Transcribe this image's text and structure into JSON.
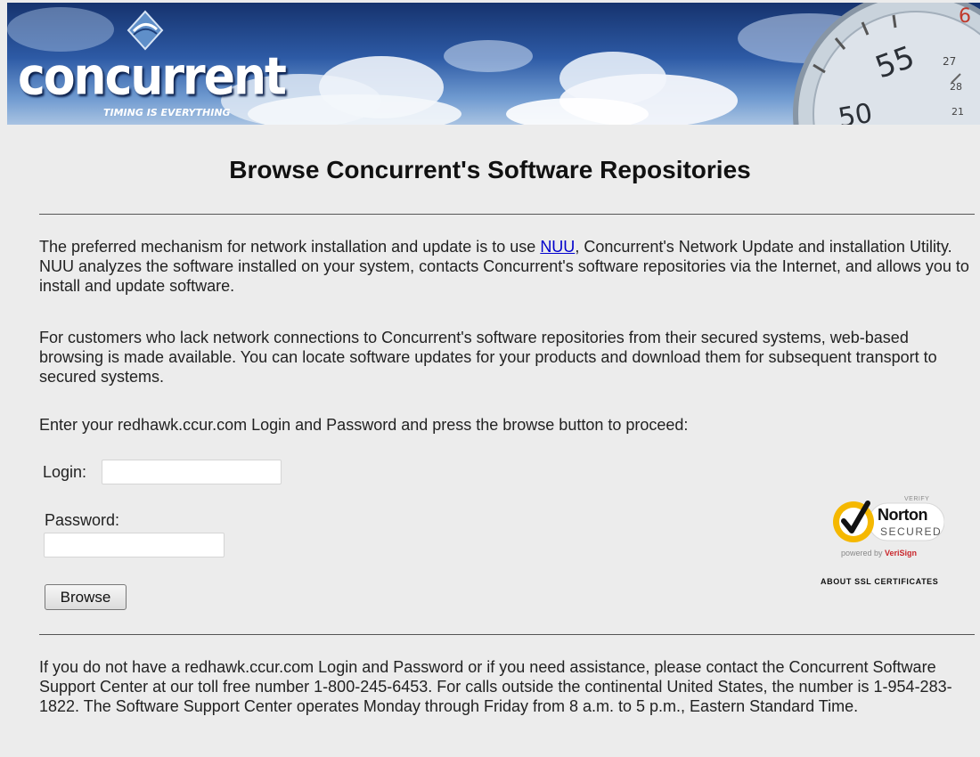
{
  "banner": {
    "logo_text": "concurrent",
    "tagline": "TIMING IS EVERYTHING",
    "stopwatch_numbers": [
      "55",
      "50",
      "6",
      "27",
      "28",
      "21"
    ]
  },
  "page_title": "Browse Concurrent's Software Repositories",
  "intro": {
    "before_link": "The preferred mechanism for network installation and update is to use ",
    "link_text": "NUU",
    "after_link": ", Concurrent's Network Update and installation Utility. NUU analyzes the software installed on your system, contacts Concurrent's software repositories via the Internet, and allows you to install and update software."
  },
  "paragraph_2": "For customers who lack network connections to Concurrent's software repositories from their secured systems, web-based browsing is made available. You can locate software updates for your products and download them for subsequent transport to secured systems.",
  "instructions": "Enter your redhawk.ccur.com Login and Password and press the browse button to proceed:",
  "form": {
    "login_label": "Login:",
    "login_value": "",
    "password_label": "Password:",
    "password_value": "",
    "browse_label": "Browse"
  },
  "norton": {
    "verify": "VERIFY",
    "name": "Norton",
    "secured": "SECURED",
    "powered_prefix": "powered by ",
    "powered_brand": "VeriSign",
    "about_link": "ABOUT SSL CERTIFICATES"
  },
  "footer": "If you do not have a redhawk.ccur.com Login and Password or if you need assistance, please contact the Concurrent Software Support Center at our toll free number 1-800-245-6453. For calls outside the continental United States, the number is 1-954-283-1822. The Software Support Center operates Monday through Friday from 8 a.m. to 5 p.m., Eastern Standard Time.",
  "colors": {
    "background": "#ececec",
    "link": "#0000cc",
    "banner_dark": "#16336e",
    "verisign_red": "#c9282d",
    "norton_yellow": "#f5b800"
  }
}
